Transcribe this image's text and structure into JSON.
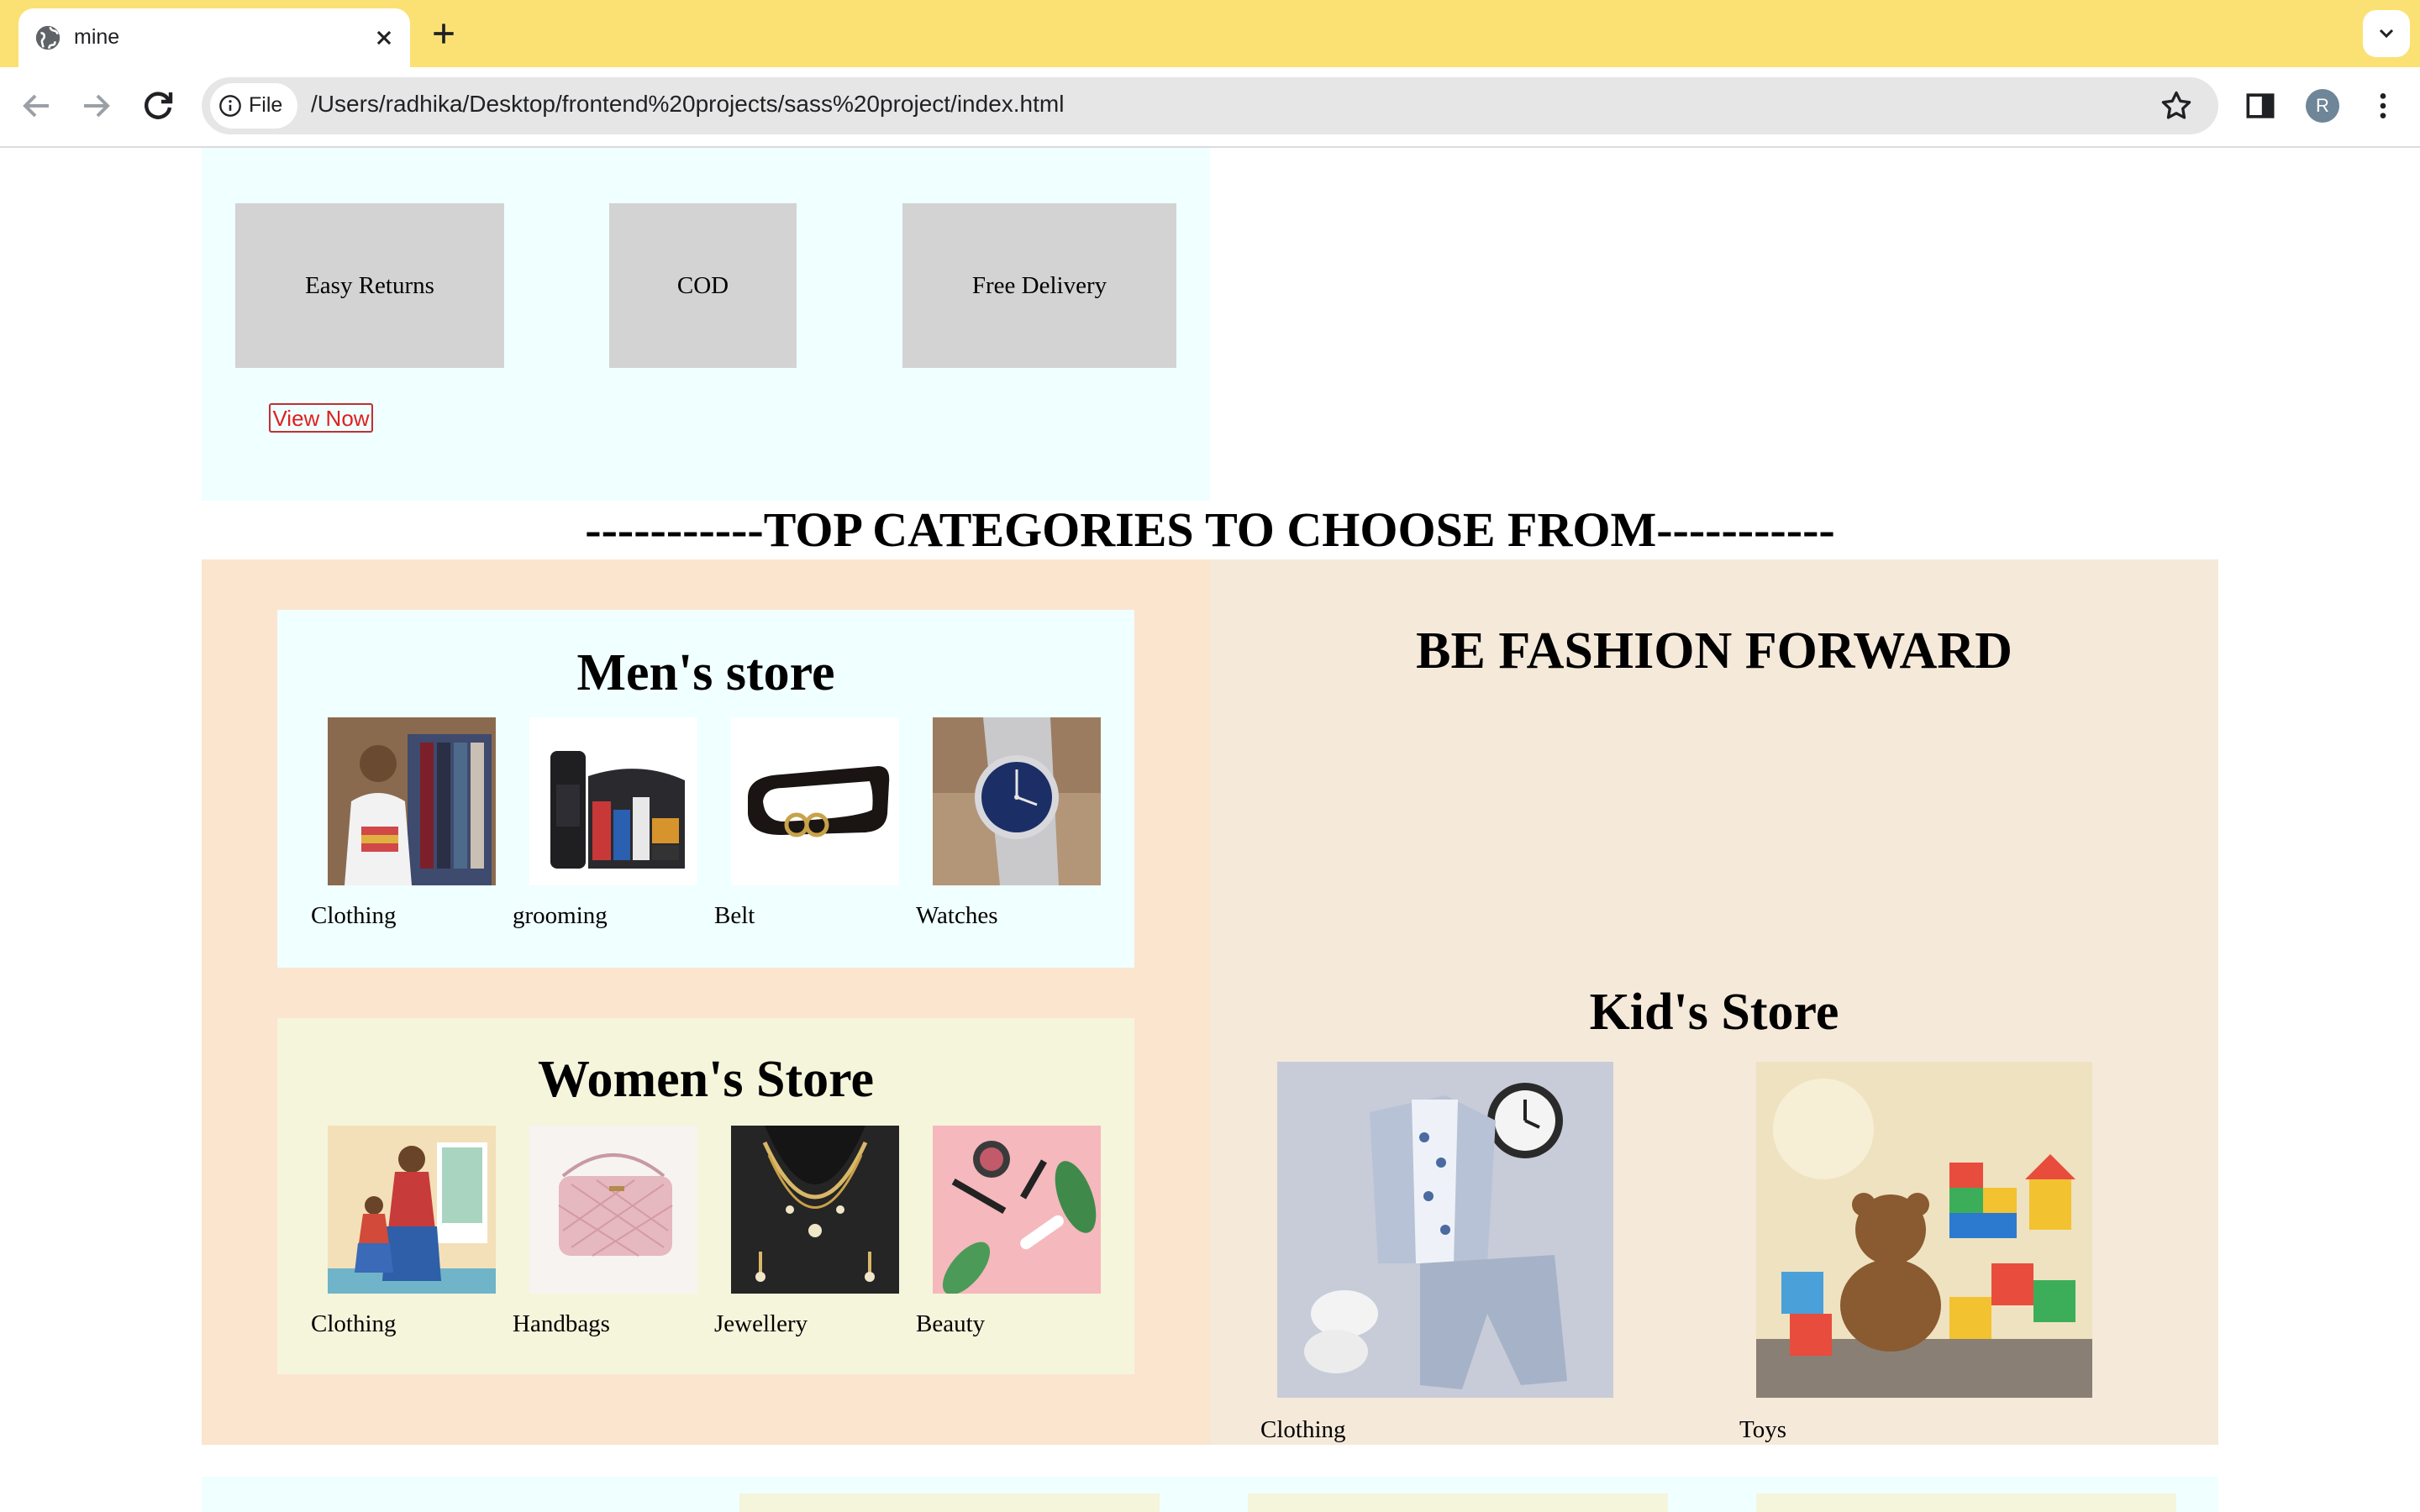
{
  "browser": {
    "tab_title": "mine",
    "chip_label": "File",
    "url": "/Users/radhika/Desktop/frontend%20projects/sass%20project/index.html",
    "avatar_initial": "R",
    "accent_color": "#fbe174"
  },
  "hero": {
    "features": [
      "Easy Returns",
      "COD",
      "Free Delivery"
    ],
    "cta_label": "View Now"
  },
  "categories_heading": "-----------TOP CATEGORIES TO CHOOSE FROM-----------",
  "mens_store": {
    "title": "Men's store",
    "items": [
      {
        "label": "Clothing",
        "icon": "mens-clothing-photo"
      },
      {
        "label": "grooming",
        "icon": "grooming-kit-photo"
      },
      {
        "label": "Belt",
        "icon": "belt-photo"
      },
      {
        "label": "Watches",
        "icon": "watch-photo"
      }
    ]
  },
  "womens_store": {
    "title": "Women's Store",
    "items": [
      {
        "label": "Clothing",
        "icon": "womens-clothing-photo"
      },
      {
        "label": "Handbags",
        "icon": "handbag-photo"
      },
      {
        "label": "Jewellery",
        "icon": "necklace-photo"
      },
      {
        "label": "Beauty",
        "icon": "makeup-photo"
      }
    ]
  },
  "fashion_banner": "BE FASHION FORWARD",
  "kids_store": {
    "title": "Kid's Store",
    "items": [
      {
        "label": "Clothing",
        "icon": "kids-outfit-photo"
      },
      {
        "label": "Toys",
        "icon": "toys-photo"
      }
    ]
  }
}
